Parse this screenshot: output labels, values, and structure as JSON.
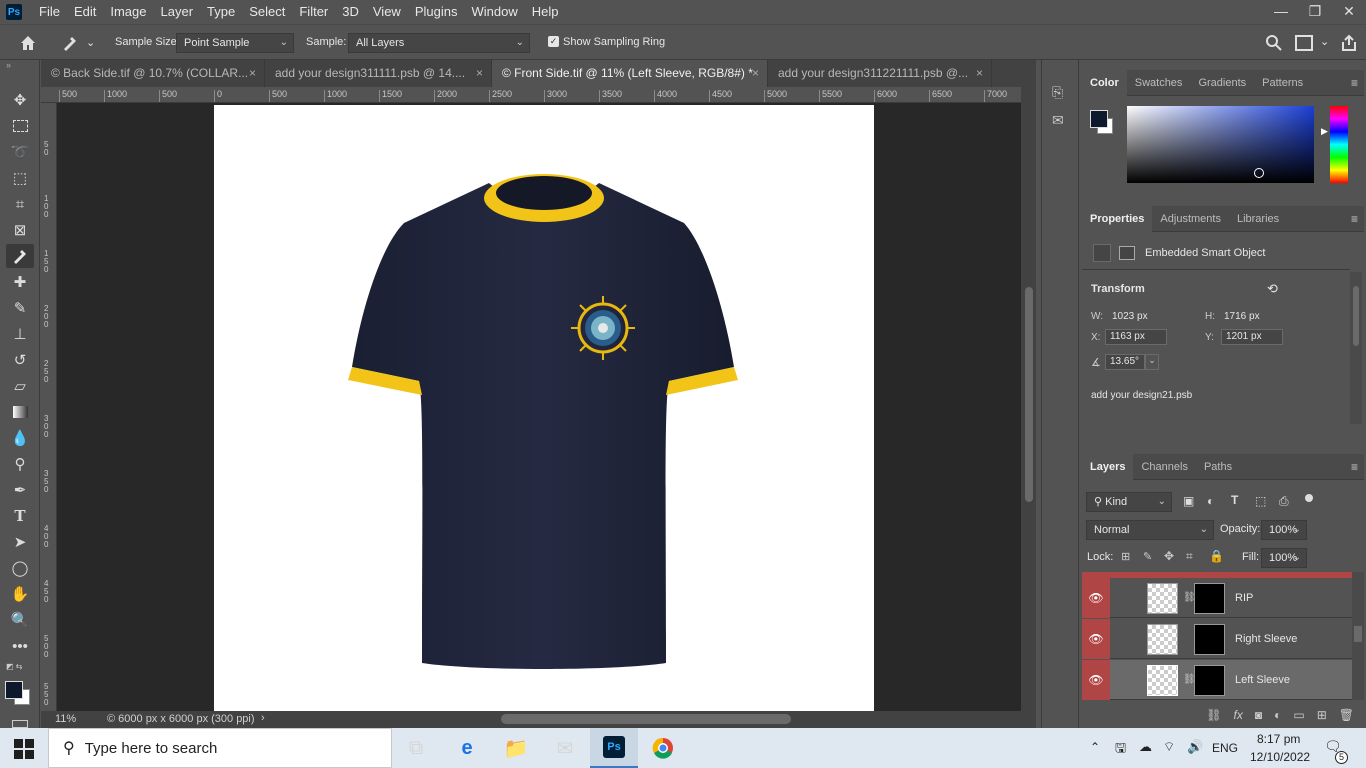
{
  "app": {
    "logo": "Ps",
    "menus": [
      "File",
      "Edit",
      "Image",
      "Layer",
      "Type",
      "Select",
      "Filter",
      "3D",
      "View",
      "Plugins",
      "Window",
      "Help"
    ]
  },
  "window_controls": {
    "minimize": "—",
    "restore": "❐",
    "close": "✕"
  },
  "options": {
    "sample_size_label": "Sample Size:",
    "sample_size_value": "Point Sample",
    "sample_label": "Sample:",
    "sample_value": "All Layers",
    "show_ring_label": "Show Sampling Ring",
    "show_ring_checked": true
  },
  "tabs": [
    {
      "label": "© Back Side.tif @ 10.7% (COLLAR...",
      "close": "×"
    },
    {
      "label": "add your design311111.psb @ 14....",
      "close": "×"
    },
    {
      "label": "© Front Side.tif @ 11% (Left Sleeve, RGB/8#) *",
      "close": "×"
    },
    {
      "label": "add your design311221111.psb @...",
      "close": "×"
    }
  ],
  "ruler_h": [
    "500",
    "1000",
    "500",
    "0",
    "500",
    "1000",
    "1500",
    "2000",
    "2500",
    "3000",
    "3500",
    "4000",
    "4500",
    "5000",
    "5500",
    "6000",
    "6500",
    "7000"
  ],
  "ruler_v": [
    "5 0",
    "1 0 0",
    "1 5 0",
    "2 0 0",
    "2 5 0",
    "3 0 0",
    "3 5 0",
    "4 0 0",
    "4 5 0",
    "5 0 0",
    "5 5 0"
  ],
  "status": {
    "zoom": "11%",
    "doc_size": "© 6000 px x 6000 px (300 ppi)",
    "arrow": "›"
  },
  "color_panel": {
    "tabs": [
      "Color",
      "Swatches",
      "Gradients",
      "Patterns"
    ],
    "foreground": "#0d1a2b",
    "background": "#ffffff",
    "hue_color": "#1a3fd6"
  },
  "properties_panel": {
    "tabs": [
      "Properties",
      "Adjustments",
      "Libraries"
    ],
    "object_type": "Embedded Smart Object",
    "transform_label": "Transform",
    "w_label": "W:",
    "w_value": "1023 px",
    "h_label": "H:",
    "h_value": "1716 px",
    "x_label": "X:",
    "x_value": "1163 px",
    "y_label": "Y:",
    "y_value": "1201 px",
    "angle_value": "13.65°",
    "linked_file": "add your design21.psb"
  },
  "layers_panel": {
    "tabs": [
      "Layers",
      "Channels",
      "Paths"
    ],
    "filter_label": "Kind",
    "blend_mode": "Normal",
    "opacity_label": "Opacity:",
    "opacity_value": "100%",
    "lock_label": "Lock:",
    "fill_label": "Fill:",
    "fill_value": "100%",
    "layers": [
      {
        "name": "RIP"
      },
      {
        "name": "Right Sleeve"
      },
      {
        "name": "Left Sleeve"
      }
    ]
  },
  "taskbar": {
    "search_placeholder": "Type here to search",
    "language": "ENG",
    "time": "8:17 pm",
    "date": "12/10/2022",
    "notifications": "5"
  }
}
